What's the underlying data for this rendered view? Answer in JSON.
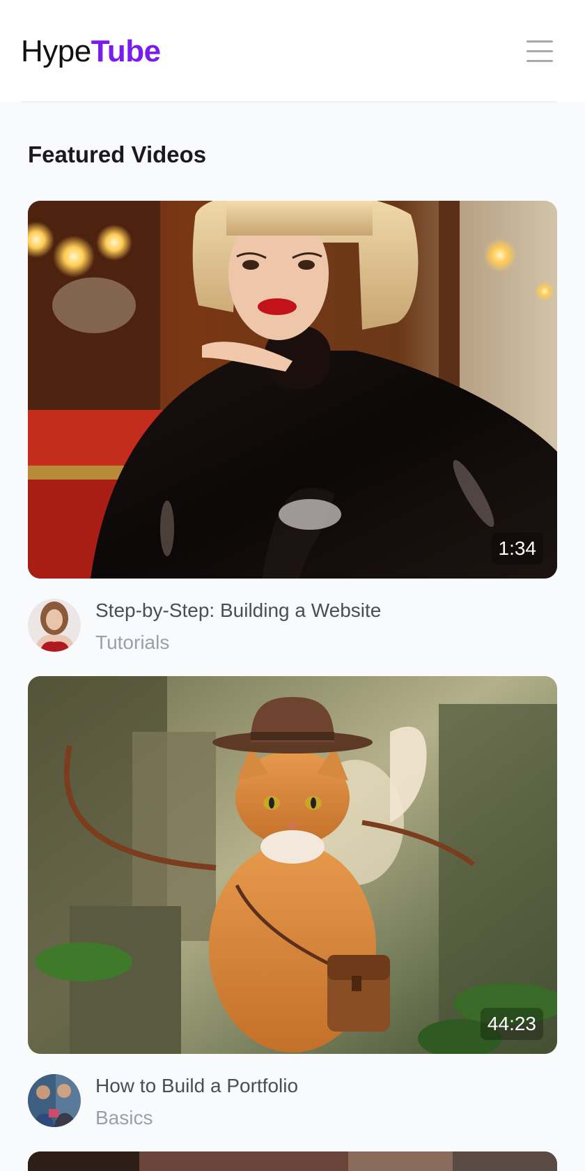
{
  "header": {
    "logo_part1": "Hype",
    "logo_part2": "Tube",
    "menu_icon": "hamburger-menu-icon"
  },
  "section": {
    "title": "Featured Videos"
  },
  "videos": [
    {
      "title": "Step-by-Step: Building a Website",
      "category": "Tutorials",
      "duration": "1:34"
    },
    {
      "title": "How to Build a Portfolio",
      "category": "Basics",
      "duration": "44:23"
    }
  ],
  "colors": {
    "brand_accent": "#7a1cf0",
    "text_primary": "#1a1a1e",
    "text_secondary": "#4a4d57",
    "text_muted": "#9aa0ab",
    "background": "#f9fafc"
  }
}
